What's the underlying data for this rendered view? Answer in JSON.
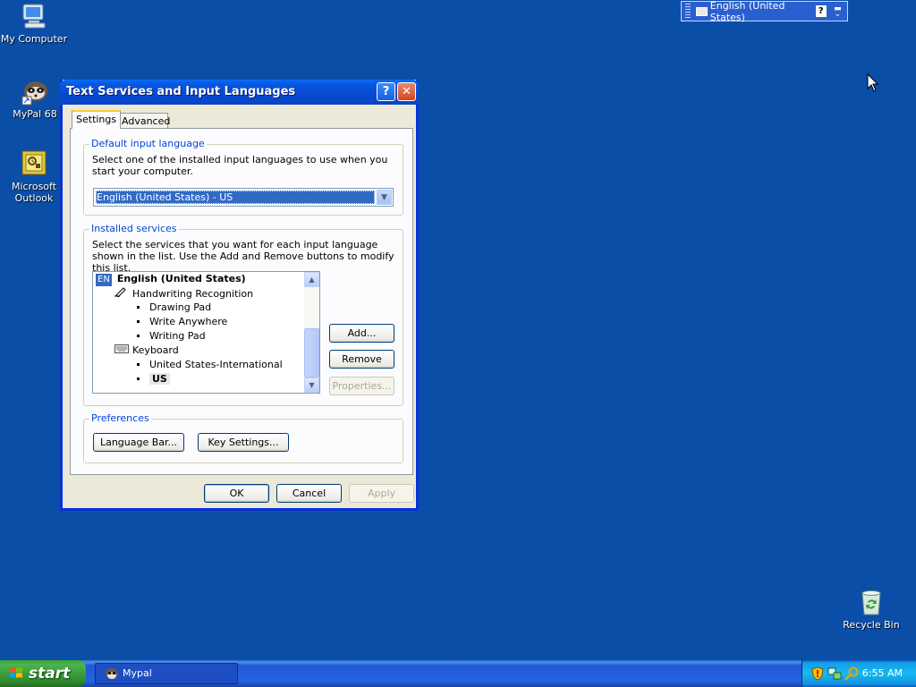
{
  "desktop": {
    "icons": [
      {
        "label": "My Computer"
      },
      {
        "label": "MyPal 68"
      },
      {
        "label": "Microsoft\nOutlook"
      },
      {
        "label": "Recycle Bin"
      }
    ]
  },
  "language_bar": {
    "language": "English (United States)",
    "help_glyph": "?"
  },
  "dialog": {
    "title": "Text Services and Input Languages",
    "help_glyph": "?",
    "close_glyph": "✕",
    "tabs": [
      {
        "label": "Settings",
        "active": true
      },
      {
        "label": "Advanced",
        "active": false
      }
    ],
    "default_input": {
      "group_label": "Default input language",
      "description": "Select one of the installed input languages to use when you start your computer.",
      "selected_value": "English (United States) - US"
    },
    "installed_services": {
      "group_label": "Installed services",
      "description": "Select the services that you want for each input language shown in the list. Use the Add and Remove buttons to modify this list.",
      "tree": {
        "language_badge": "EN",
        "language": "English (United States)",
        "handwriting": "Handwriting Recognition",
        "handwriting_items": [
          "Drawing Pad",
          "Write Anywhere",
          "Writing Pad"
        ],
        "keyboard": "Keyboard",
        "keyboard_items": [
          "United States-International",
          "US"
        ]
      },
      "buttons": {
        "add": "Add...",
        "remove": "Remove",
        "properties": "Properties..."
      }
    },
    "preferences": {
      "group_label": "Preferences",
      "language_bar_button": "Language Bar...",
      "key_settings_button": "Key Settings..."
    },
    "footer": {
      "ok": "OK",
      "cancel": "Cancel",
      "apply": "Apply"
    }
  },
  "taskbar": {
    "start_label": "start",
    "task": "Mypal",
    "clock": "6:55 AM"
  },
  "colors": {
    "desktop": "#0a4ea8",
    "title_bar": "#0749d0",
    "selection": "#316ac5",
    "group_label": "#0046d5"
  }
}
